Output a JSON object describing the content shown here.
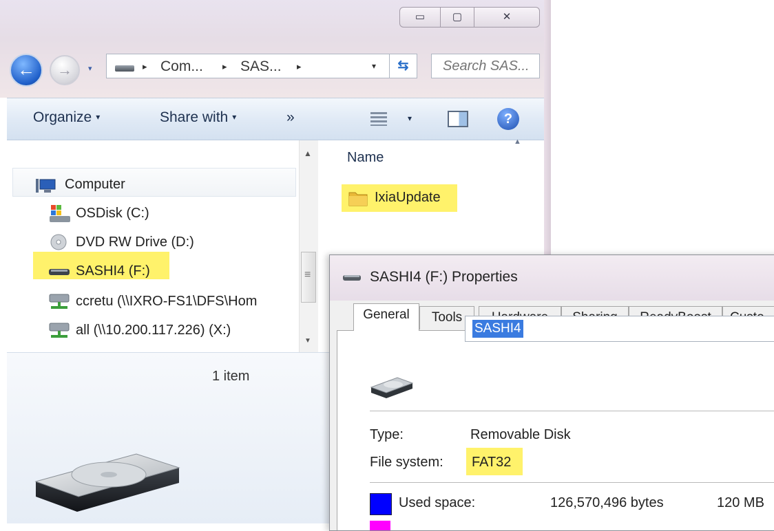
{
  "explorer": {
    "caption_buttons": {
      "minimize": "▭",
      "maximize": "▢",
      "close": "✕"
    },
    "nav": {
      "back_glyph": "←",
      "forward_glyph": "→",
      "history_glyph": "▾"
    },
    "address": {
      "crumbs": [
        "Com...",
        "SAS..."
      ],
      "separator": "▸",
      "dropdown_glyph": "▾",
      "refresh_glyph": "⇆"
    },
    "search": {
      "placeholder": "Search SAS..."
    },
    "commands": {
      "organize": "Organize",
      "share_with": "Share with",
      "more": "»",
      "dropdown_glyph": "▾",
      "help_glyph": "?"
    },
    "nav_pane": {
      "items": [
        {
          "label": "Computer",
          "icon": "computer-icon"
        },
        {
          "label": "OSDisk (C:)",
          "icon": "windows-drive-icon"
        },
        {
          "label": "DVD RW Drive (D:)",
          "icon": "dvd-drive-icon"
        },
        {
          "label": "SASHI4 (F:)",
          "icon": "removable-drive-icon"
        },
        {
          "label": "ccretu (\\\\IXRO-FS1\\DFS\\Hom",
          "icon": "network-drive-icon"
        },
        {
          "label": "all (\\\\10.200.117.226) (X:)",
          "icon": "network-drive-icon"
        }
      ],
      "scroll_up": "▲",
      "scroll_down": "▼",
      "scroll_grip": "≡"
    },
    "file_list": {
      "column_name": "Name",
      "sort_glyph": "▲",
      "items": [
        {
          "label": "IxiaUpdate",
          "icon": "folder-icon"
        }
      ]
    },
    "status": {
      "item_count": "1 item"
    },
    "highlight_color": "#fff26b"
  },
  "properties": {
    "title": "SASHI4 (F:) Properties",
    "tabs": [
      "General",
      "Tools",
      "Hardware",
      "Sharing",
      "ReadyBoost",
      "Custo"
    ],
    "active_tab": "General",
    "name_value": "SASHI4",
    "type_label": "Type:",
    "type_value": "Removable Disk",
    "fs_label": "File system:",
    "fs_value": "FAT32",
    "used_label": "Used space:",
    "used_bytes": "126,570,496 bytes",
    "used_size": "120 MB",
    "used_color": "#0000ff",
    "free_color": "#ff00ff"
  }
}
